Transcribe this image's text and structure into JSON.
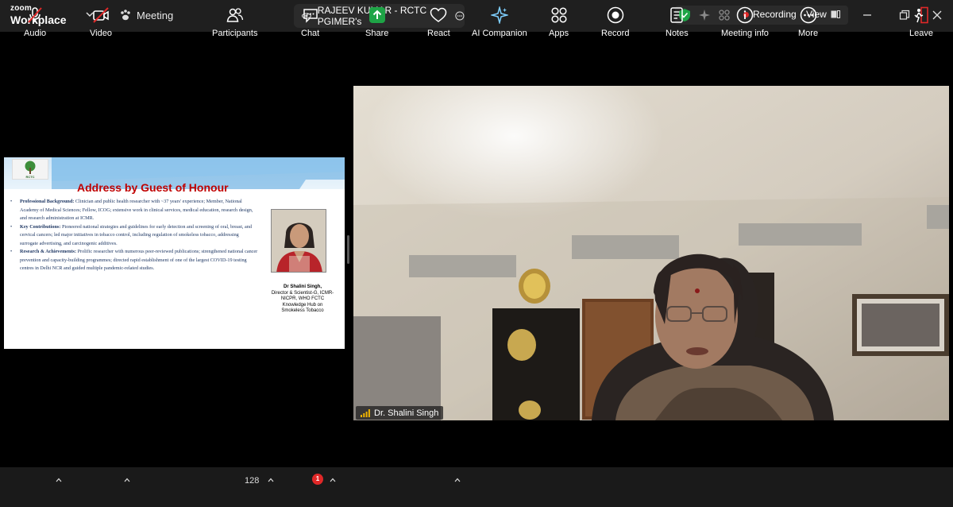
{
  "app": {
    "brand_top": "zoom",
    "brand_bottom": "Workplace"
  },
  "titlebar": {
    "meeting_label": "Meeting",
    "tab_title": "RAJEEV KUMAR - RCTC PGIMER's",
    "recording_label": "Recording",
    "view_label": "View",
    "colors": {
      "bar": "#1f1f1f",
      "shield": "#1ea446",
      "rec": "#e02828"
    }
  },
  "slide": {
    "logo_text": "RCTC",
    "title": "Address by Guest of Honour",
    "bullets": [
      {
        "head": "Professional Background:",
        "body": " Clinician and public health researcher with ~37 years' experience; Member, National Academy of Medical Sciences; Fellow, ICOG; extensive work in clinical services, medical education, research design, and research administration at ICMR."
      },
      {
        "head": "Key Contributions:",
        "body": " Pioneered national strategies and guidelines for early detection and screening of oral, breast, and cervical cancers; led major initiatives in tobacco control, including regulation of smokeless tobacco, addressing surrogate advertising, and carcinogenic additives."
      },
      {
        "head": "Research & Achievements:",
        "body": " Prolific researcher with numerous peer-reviewed publications; strengthened national cancer prevention and capacity-building programmes; directed rapid establishment of one of the largest COVID-19 testing centres in Delhi NCR and guided multiple pandemic-related studies."
      }
    ],
    "caption_name": "Dr Shalini Singh,",
    "caption_role": "Director & Scientist-G, ICMR-NICPR, WHO FCTC Knowledge Hub on Smokeless Tobacco"
  },
  "video": {
    "participant_name": "Dr. Shalini Singh"
  },
  "toolbar": {
    "audio": "Audio",
    "video": "Video",
    "participants": "Participants",
    "participants_count": "128",
    "chat": "Chat",
    "chat_badge": "1",
    "share": "Share",
    "react": "React",
    "ai_companion": "AI Companion",
    "apps": "Apps",
    "record": "Record",
    "notes": "Notes",
    "meeting_info": "Meeting info",
    "more": "More",
    "leave": "Leave",
    "colors": {
      "share_green": "#1ea446",
      "muted_red": "#e02828",
      "leave_red": "#e02828"
    }
  }
}
